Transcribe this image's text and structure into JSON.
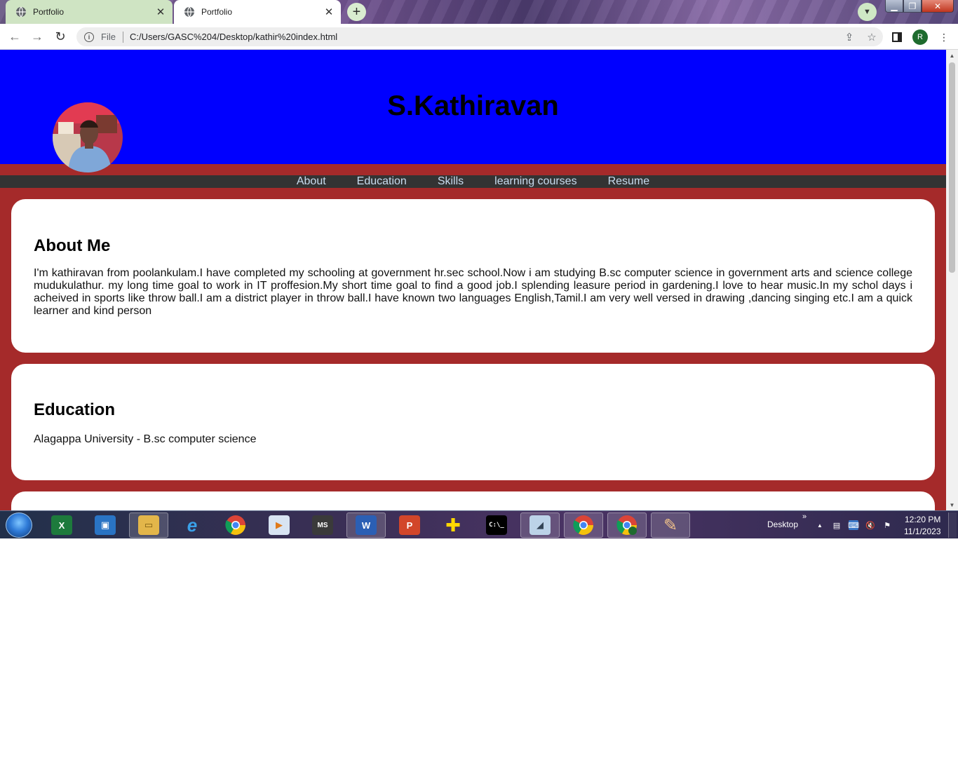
{
  "browser": {
    "tabs": [
      {
        "title": "Portfolio",
        "active": false
      },
      {
        "title": "Portfolio",
        "active": true
      }
    ],
    "new_tab_symbol": "+",
    "address": {
      "scheme_label": "File",
      "url": "C:/Users/GASC%204/Desktop/kathir%20index.html"
    },
    "profile_initial": "R",
    "window_controls": {
      "minimize": "▁",
      "maximize": "❐",
      "close": "✕"
    }
  },
  "page": {
    "header_name": "S.Kathiravan",
    "nav": [
      "About",
      "Education",
      "Skills",
      "learning courses",
      "Resume"
    ],
    "about": {
      "heading": "About Me",
      "text": "I'm kathiravan from poolankulam.I have completed my schooling at government hr.sec school.Now i am studying B.sc computer science in government arts and science college mudukulathur. my long time goal to work in IT proffesion.My short time goal to find a good job.I splending leasure period in gardening.I love to hear music.In my schol days i acheived in sports like throw ball.I am a district player in throw ball.I have known two languages English,Tamil.I am very well versed in drawing ,dancing singing etc.I am a quick learner and kind person"
    },
    "education": {
      "heading": "Education",
      "text": "Alagappa University - B.sc computer science"
    },
    "colors": {
      "header_bg": "#0000ff",
      "page_bg": "#a52a2a",
      "nav_bg": "#333333",
      "nav_link": "#c8dcef",
      "card_bg": "#ffffff"
    }
  },
  "taskbar": {
    "apps": [
      "windows-start",
      "excel",
      "remote-desktop",
      "file-explorer",
      "internet-explorer",
      "chrome",
      "media-player",
      "ms-office-tool",
      "word",
      "powerpoint",
      "medical-app",
      "command-prompt",
      "notepad-app",
      "chrome",
      "chrome-profile",
      "paint"
    ],
    "desktop_label": "Desktop",
    "expand_label": "»",
    "time": "12:20 PM",
    "date": "11/1/2023"
  }
}
